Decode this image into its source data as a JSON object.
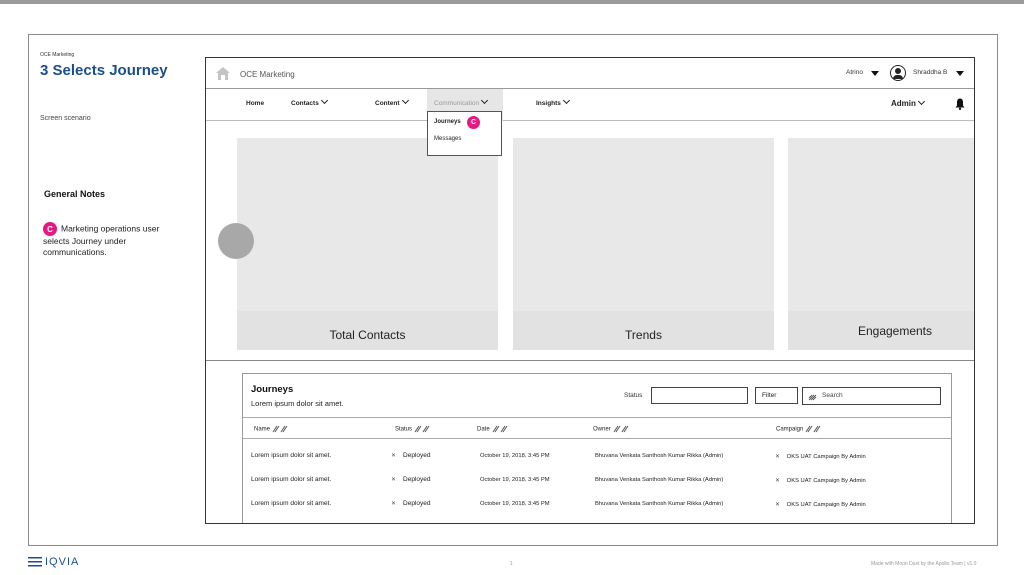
{
  "slide": {
    "section": "OCE Marketing",
    "title": "3   Selects Journey",
    "scenario": "Screen scenario",
    "notes_heading": "General Notes",
    "note_badge": "C",
    "note_text": "Marketing operations user selects Journey under communications."
  },
  "app": {
    "title": "OCE Marketing",
    "tenant": "Atrino",
    "user": "Shraddha B"
  },
  "nav": {
    "home": "Home",
    "contacts": "Contacts",
    "content": "Content",
    "communication": "Communication",
    "insights": "Insights",
    "admin": "Admin"
  },
  "dropdown": {
    "items": [
      "Journeys",
      "Messages"
    ],
    "badge": "C"
  },
  "cards": [
    "Total Contacts",
    "Trends",
    "Engagements"
  ],
  "journeys_table": {
    "title": "Journeys",
    "subtitle": "Lorem ipsum dolor sit amet.",
    "status_label": "Status",
    "filter_label": "Filter",
    "search_placeholder": "Search",
    "columns": [
      "Name",
      "Status",
      "Date",
      "Owner",
      "Campaign"
    ],
    "rows": [
      [
        "Lorem ipsum dolor sit amet.",
        "Deployed",
        "October 19, 2018, 3:45 PM",
        "Bhuvana Venkata Santhosh Kumar Rikka (Admin)",
        "DKS UAT Campaign By Admin"
      ],
      [
        "Lorem ipsum dolor sit amet.",
        "Deployed",
        "October 19, 2018, 3:45 PM",
        "Bhuvana Venkata Santhosh Kumar Rikka (Admin)",
        "DKS UAT Campaign By Admin"
      ],
      [
        "Lorem ipsum dolor sit amet.",
        "Deployed",
        "October 19, 2018, 3:45 PM",
        "Bhuvana Venkata Santhosh Kumar Rikka (Admin)",
        "DKS UAT Campaign By Admin"
      ]
    ]
  },
  "footer": {
    "logo": "IQVIA",
    "page_number": "1",
    "credit": "Made with Moon Dust by the Apollo Team  |  v1.0"
  },
  "colors": {
    "title_blue": "#1b4f8a",
    "badge_pink": "#e5197f"
  }
}
